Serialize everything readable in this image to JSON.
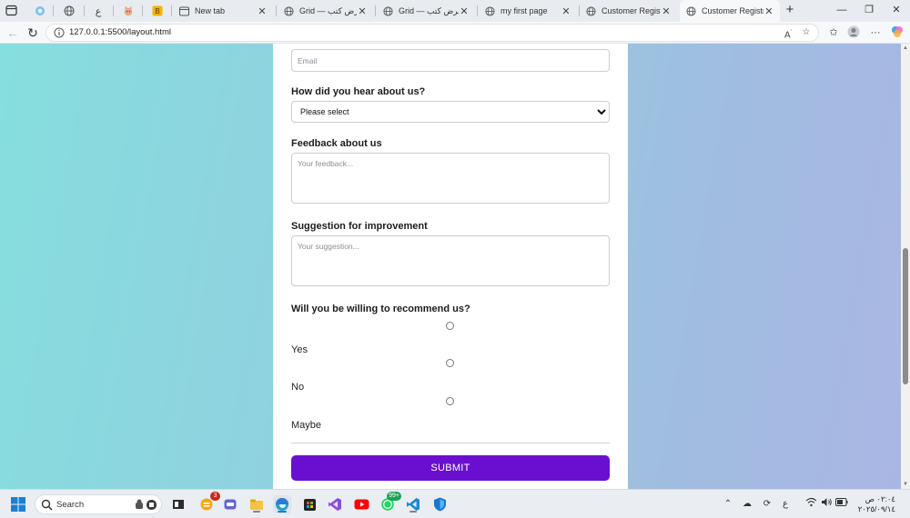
{
  "browser": {
    "pinned_tabs": [
      "edge-icon",
      "globe-icon",
      "arabic-character-icon",
      "cat-icon",
      "bookmark-icon"
    ],
    "tabs": [
      {
        "title": "New tab",
        "icon": "newtab-icon",
        "active": false
      },
      {
        "title": "Grid — معرض كتب",
        "icon": "globe-icon",
        "active": false
      },
      {
        "title": "Grid — معرض كتب",
        "icon": "globe-icon",
        "active": false
      },
      {
        "title": "my first page",
        "icon": "globe-icon",
        "active": false
      },
      {
        "title": "Customer Registratio",
        "icon": "globe-icon",
        "active": false
      },
      {
        "title": "Customer Registratio",
        "icon": "globe-icon",
        "active": true
      }
    ],
    "url": "127.0.0.1:5500/layout.html",
    "pinned_label": "ع"
  },
  "form": {
    "email_placeholder": "Email",
    "hear_label": "How did you hear about us?",
    "hear_selected": "Please select",
    "feedback_label": "Feedback about us",
    "feedback_placeholder": "Your feedback...",
    "suggestion_label": "Suggestion for improvement",
    "suggestion_placeholder": "Your suggestion...",
    "recommend_label": "Will you be willing to recommend us?",
    "options": [
      "Yes",
      "No",
      "Maybe"
    ],
    "submit_label": "SUBMIT"
  },
  "taskbar": {
    "search_label": "Search",
    "apps": [
      {
        "name": "widgets-icon",
        "badge": "3"
      },
      {
        "name": "file-explorer-dark-icon"
      },
      {
        "name": "teams-icon"
      },
      {
        "name": "file-explorer-icon"
      },
      {
        "name": "edge-icon"
      },
      {
        "name": "store-icon"
      },
      {
        "name": "visual-studio-icon"
      },
      {
        "name": "youtube-icon"
      },
      {
        "name": "whatsapp-icon",
        "badge": "99+"
      },
      {
        "name": "vscode-icon"
      },
      {
        "name": "defender-icon"
      }
    ],
    "tray_lang": "ع",
    "clock_time": "٠٢:٠٤ ص",
    "clock_date": "٢٠٢٥/٠٩/١٤"
  },
  "colors": {
    "accent": "#6a0fd0",
    "bg_left": "#86dede",
    "bg_right": "#aab6e4"
  }
}
